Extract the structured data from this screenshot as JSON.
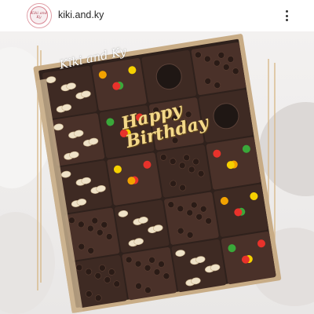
{
  "header": {
    "username": "kiki.and.ky",
    "avatar_text": "Kiki and Ky"
  },
  "post": {
    "brand_watermark": "Kiki and Ky",
    "topper_text": "Happy Birthday",
    "colors": {
      "brownie": "#3b2a24",
      "box": "#c9b08b",
      "gold_frame": "#d9b98a",
      "background": "#eceaea"
    }
  },
  "icons": {
    "more": "more-vertical-icon"
  }
}
